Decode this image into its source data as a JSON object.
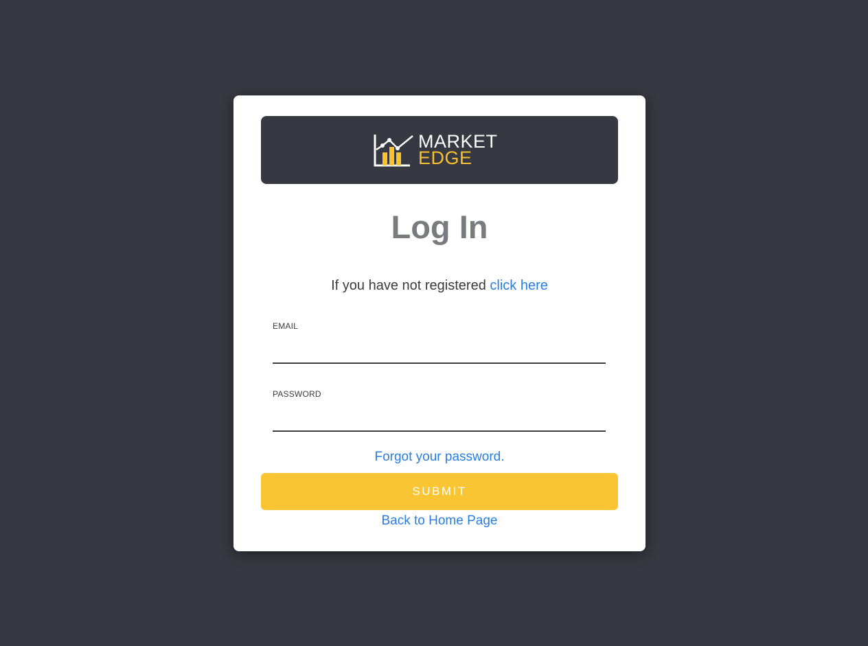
{
  "logo": {
    "line1": "MARKET",
    "line2": "EDGE"
  },
  "title": "Log In",
  "register": {
    "text": "If you have not registered ",
    "link": "click here"
  },
  "form": {
    "email_label": "EMAIL",
    "email_value": "",
    "password_label": "PASSWORD",
    "password_value": ""
  },
  "forgot_link": "Forgot your password.",
  "submit_label": "SUBMIT",
  "back_link": "Back to Home Page",
  "colors": {
    "background": "#363941",
    "accent": "#f9c532",
    "link": "#2a7de1",
    "title": "#7a7b7e"
  },
  "icons": {
    "logo": "chart-growth-icon"
  }
}
